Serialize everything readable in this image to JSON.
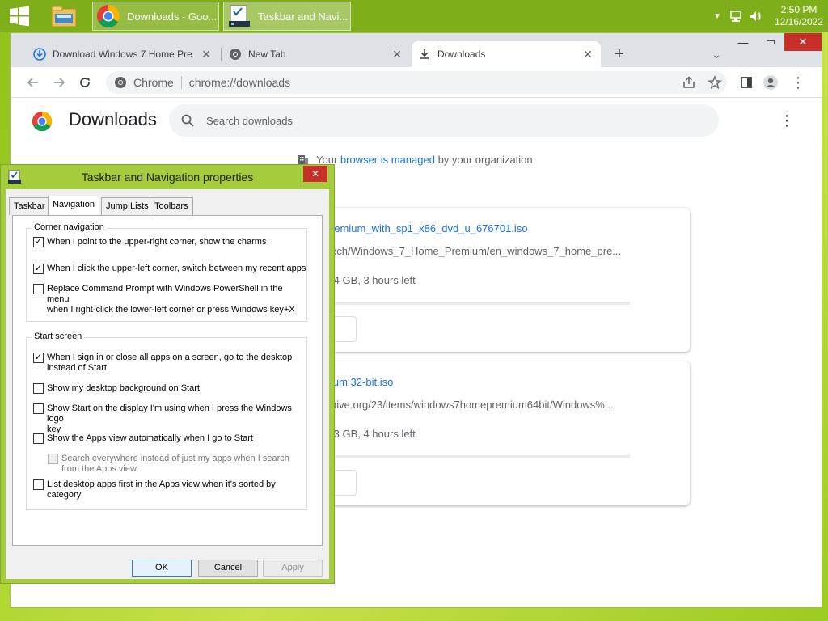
{
  "taskbar": {
    "apps": [
      {
        "label": "Downloads - Goo...",
        "icon": "chrome-icon",
        "active": false
      },
      {
        "label": "Taskbar and Navi...",
        "icon": "taskbar-properties-icon",
        "active": true
      }
    ],
    "clock": {
      "time": "2:50 PM",
      "date": "12/16/2022"
    }
  },
  "browser": {
    "tabs": [
      {
        "title": "Download Windows 7 Home Pre",
        "icon": "download-icon"
      },
      {
        "title": "New Tab",
        "icon": "chrome-icon"
      },
      {
        "title": "Downloads",
        "icon": "download-icon"
      }
    ],
    "omnibox": {
      "site_label": "Chrome",
      "url": "chrome://downloads"
    }
  },
  "downloads": {
    "title": "Downloads",
    "search_placeholder": "Search downloads",
    "managed": {
      "prefix": "Your ",
      "link": "browser is managed",
      "suffix": " by your organization"
    },
    "items": [
      {
        "file": "remium_with_sp1_x86_dvd_u_676701.iso",
        "url": "ech/Windows_7_Home_Premium/en_windows_7_home_pre...",
        "status": ".4 GB, 3 hours left"
      },
      {
        "file": "ium 32-bit.iso",
        "url": "hive.org/23/items/windows7homepremium64bit/Windows%...",
        "status": ".3 GB, 4 hours left"
      }
    ]
  },
  "dialog": {
    "title": "Taskbar and Navigation properties",
    "tabs": [
      "Taskbar",
      "Navigation",
      "Jump Lists",
      "Toolbars"
    ],
    "corner_group": "Corner navigation",
    "corner_options": [
      {
        "lines": [
          "When I point to the upper-right corner, show the charms"
        ],
        "checked": true
      },
      {
        "lines": [
          "When I click the upper-left corner, switch between my recent apps"
        ],
        "checked": true
      },
      {
        "lines": [
          "Replace Command Prompt with Windows PowerShell in the menu",
          "when I right-click the lower-left corner or press Windows key+X"
        ],
        "checked": false
      }
    ],
    "start_group": "Start screen",
    "start_options": [
      {
        "lines": [
          "When I sign in or close all apps on a screen, go to the desktop",
          "instead of Start"
        ],
        "checked": true
      },
      {
        "lines": [
          "Show my desktop background on Start"
        ],
        "checked": false
      },
      {
        "lines": [
          "Show Start on the display I'm using when I press the Windows logo",
          "key"
        ],
        "checked": false
      },
      {
        "lines": [
          "Show the Apps view automatically when I go to Start"
        ],
        "checked": false
      },
      {
        "lines": [
          "Search everywhere instead of just my apps when I search",
          "from the Apps view"
        ],
        "checked": false,
        "disabled": true
      },
      {
        "lines": [
          "List desktop apps first in the Apps view when it's sorted by",
          "category"
        ],
        "checked": false
      }
    ],
    "buttons": {
      "ok": "OK",
      "cancel": "Cancel",
      "apply": "Apply"
    }
  }
}
